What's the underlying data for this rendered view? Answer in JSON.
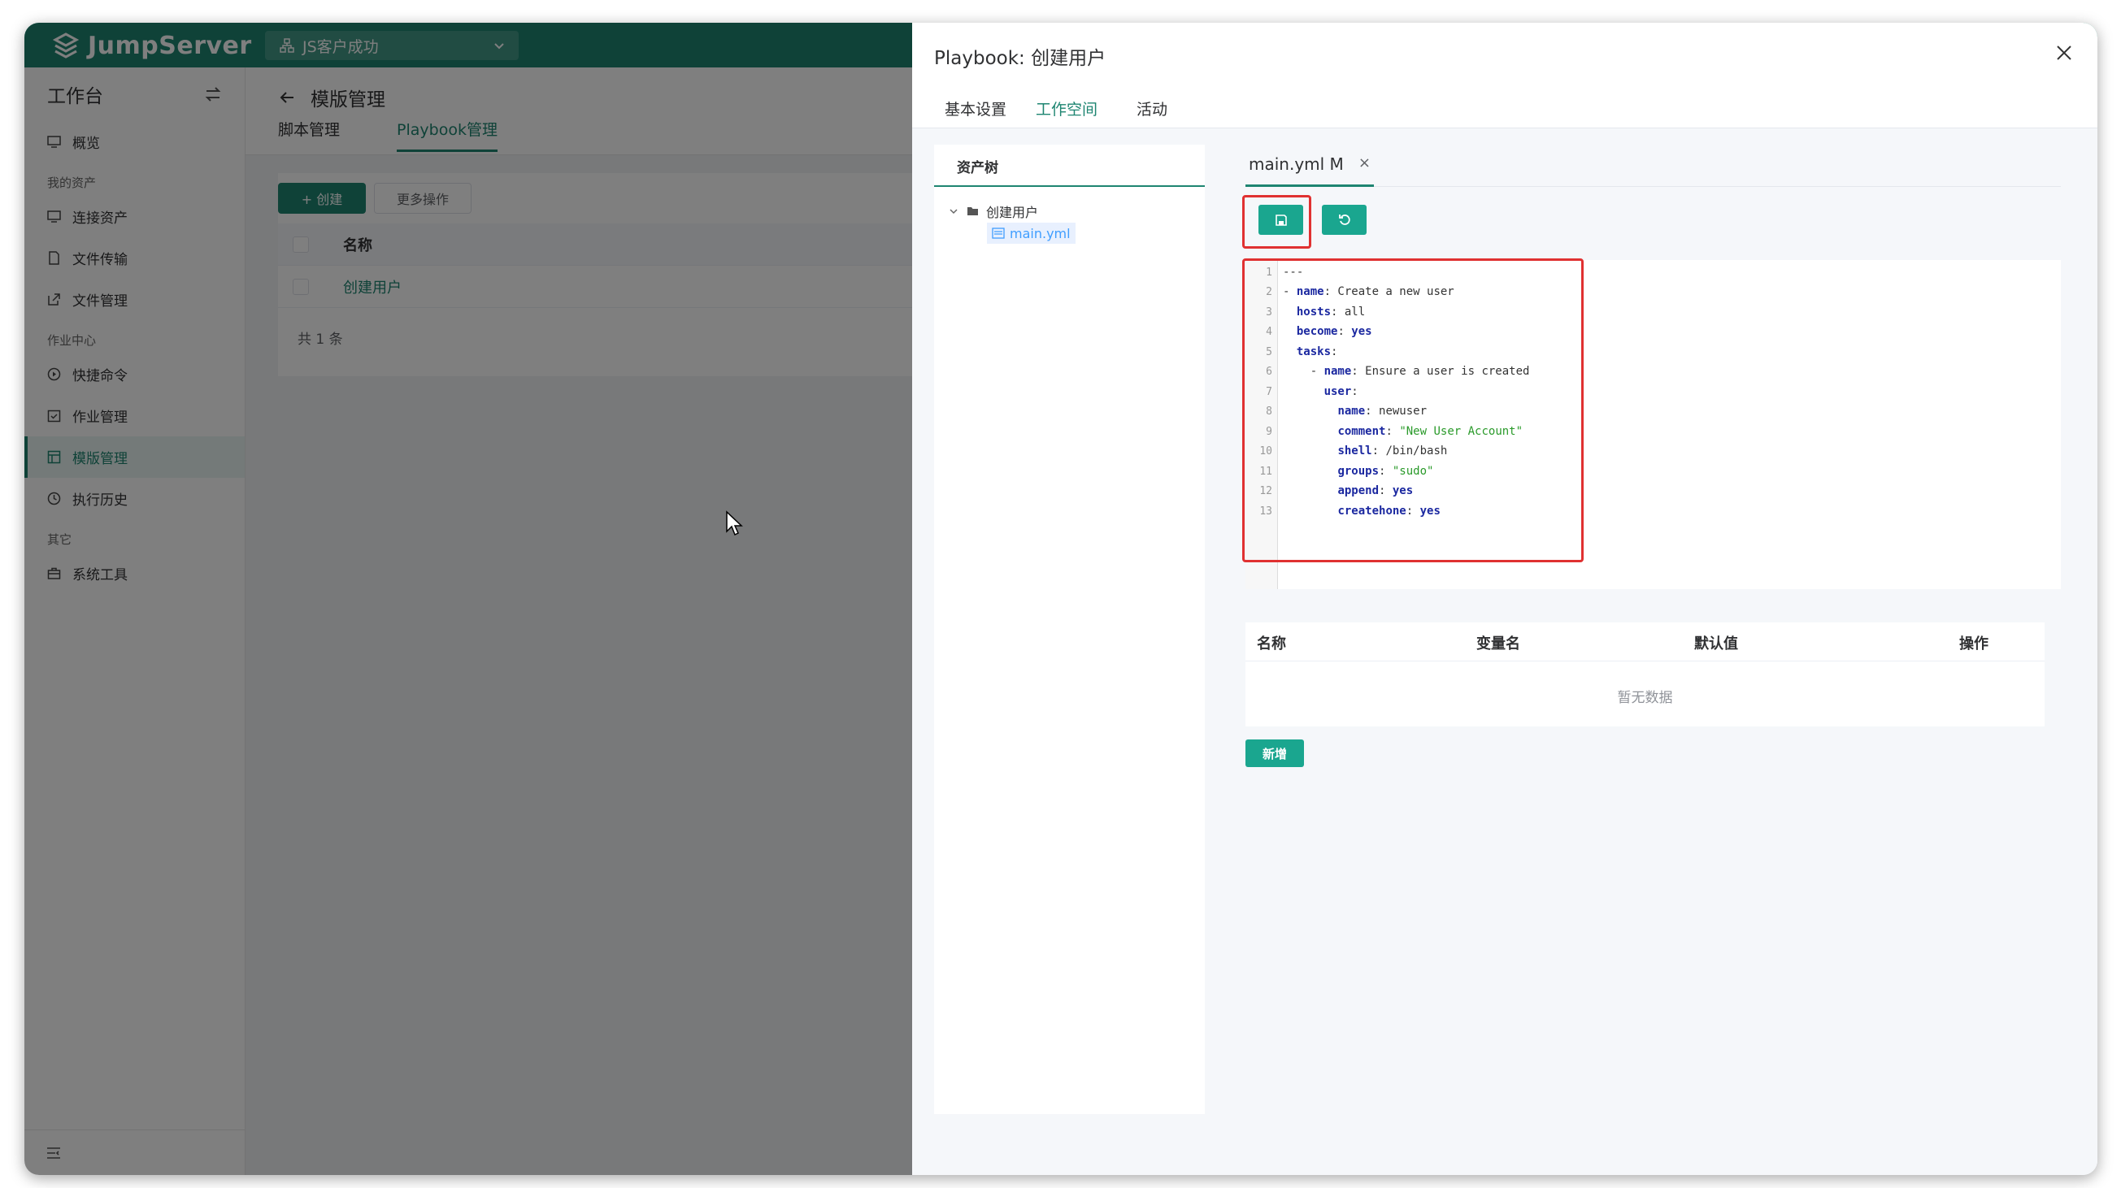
{
  "header": {
    "logo_text": "JumpServer",
    "org_name": "JS客户成功"
  },
  "sidebar": {
    "workspace_title": "工作台",
    "items": [
      {
        "label": "概览",
        "group": ""
      },
      {
        "label": "连接资产",
        "group": "我的资产"
      },
      {
        "label": "文件传输",
        "group": "我的资产"
      },
      {
        "label": "文件管理",
        "group": "我的资产"
      },
      {
        "label": "快捷命令",
        "group": "作业中心"
      },
      {
        "label": "作业管理",
        "group": "作业中心"
      },
      {
        "label": "模版管理",
        "group": "作业中心",
        "active": true
      },
      {
        "label": "执行历史",
        "group": "作业中心"
      },
      {
        "label": "系统工具",
        "group": "其它"
      }
    ],
    "groups": [
      "我的资产",
      "作业中心",
      "其它"
    ]
  },
  "page": {
    "title": "模版管理",
    "tabs": [
      "脚本管理",
      "Playbook管理"
    ],
    "create_button": "+ 创建",
    "more_button": "更多操作",
    "table": {
      "column_name": "名称",
      "rows": [
        "创建用户"
      ],
      "footer": "共 1 条"
    }
  },
  "drawer": {
    "title": "Playbook: 创建用户",
    "tabs": [
      "基本设置",
      "工作空间",
      "活动"
    ],
    "active_tab": "工作空间",
    "tree": {
      "header": "资产树",
      "folder": "创建用户",
      "file": "main.yml"
    },
    "file_tab": {
      "name": "main.yml M",
      "close": "×"
    },
    "code_lines": [
      "---",
      "- name: Create a new user",
      "  hosts: all",
      "  become: yes",
      "  tasks:",
      "    - name: Ensure a user is created",
      "      user:",
      "        name: newuser",
      "        comment: \"New User Account\"",
      "        shell: /bin/bash",
      "        groups: \"sudo\"",
      "        append: yes",
      "        createhone: yes"
    ],
    "vars_table": {
      "columns": [
        "名称",
        "变量名",
        "默认值",
        "操作"
      ],
      "empty_text": "暂无数据"
    },
    "add_button": "新增"
  },
  "colors": {
    "brand": "#1e8571",
    "button": "#1aa68f",
    "highlight": "#e03131",
    "link": "#409eff"
  }
}
